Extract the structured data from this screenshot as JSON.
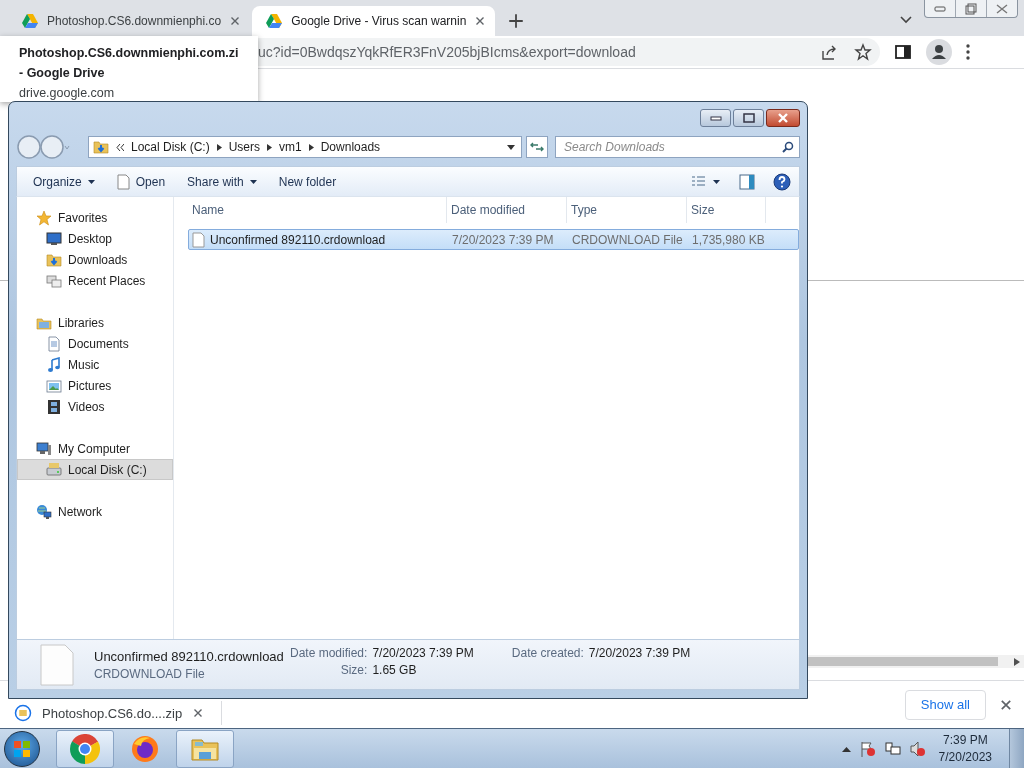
{
  "browser": {
    "tabs": [
      {
        "title": "Photoshop.CS6.downmienphi.co",
        "selected": false
      },
      {
        "title": "Google Drive - Virus scan warnin",
        "selected": true
      }
    ],
    "address": "uc?id=0BwdqszYqkRfER3FnV205bjBIcms&export=download",
    "tooltip": {
      "title": "Photoshop.CS6.downmienphi.com.zi - Google Drive",
      "url": "drive.google.com"
    },
    "downloads": {
      "item": "Photoshop.CS6.do....zip",
      "show_all": "Show all"
    }
  },
  "explorer": {
    "breadcrumb": [
      "Local Disk (C:)",
      "Users",
      "vm1",
      "Downloads"
    ],
    "search_placeholder": "Search Downloads",
    "commands": [
      {
        "label": "Organize",
        "kind": "menu"
      },
      {
        "label": "Open",
        "kind": "file"
      },
      {
        "label": "Share with",
        "kind": "menu"
      },
      {
        "label": "New folder",
        "kind": "plain"
      }
    ],
    "nav": [
      {
        "label": "Favorites",
        "kind": "star",
        "selected": false,
        "children": [
          {
            "label": "Desktop",
            "kind": "desktop",
            "selected": false
          },
          {
            "label": "Downloads",
            "kind": "downloads",
            "selected": false
          },
          {
            "label": "Recent Places",
            "kind": "recent",
            "selected": false
          }
        ]
      },
      {
        "label": "Libraries",
        "kind": "library",
        "selected": false,
        "children": [
          {
            "label": "Documents",
            "kind": "documents",
            "selected": false
          },
          {
            "label": "Music",
            "kind": "music",
            "selected": false
          },
          {
            "label": "Pictures",
            "kind": "pictures",
            "selected": false
          },
          {
            "label": "Videos",
            "kind": "videos",
            "selected": false
          }
        ]
      },
      {
        "label": "My Computer",
        "kind": "computer",
        "selected": false,
        "children": [
          {
            "label": "Local Disk (C:)",
            "kind": "drive",
            "selected": true
          }
        ]
      },
      {
        "label": "Network",
        "kind": "network",
        "selected": false
      }
    ],
    "columns": [
      "Name",
      "Date modified",
      "Type",
      "Size"
    ],
    "rows": [
      {
        "name": "Unconfirmed 892110.crdownload",
        "date_modified": "7/20/2023 7:39 PM",
        "type": "CRDOWNLOAD File",
        "size": "1,735,980 KB",
        "selected": true
      }
    ],
    "details": {
      "name": "Unconfirmed 892110.crdownload",
      "type": "CRDOWNLOAD File",
      "fields": [
        {
          "label": "Date modified:",
          "value": "7/20/2023 7:39 PM"
        },
        {
          "label": "Size:",
          "value": "1.65 GB"
        },
        {
          "label": "Date created:",
          "value": "7/20/2023 7:39 PM"
        }
      ]
    }
  },
  "taskbar": {
    "apps": [
      {
        "kind": "chrome",
        "active": true
      },
      {
        "kind": "firefox",
        "active": false
      },
      {
        "kind": "explorer",
        "active": true
      }
    ],
    "time": "7:39 PM",
    "date": "7/20/2023"
  }
}
